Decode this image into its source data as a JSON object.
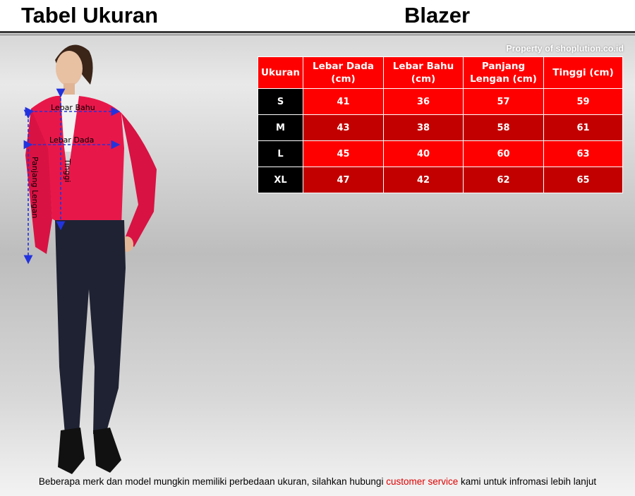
{
  "header": {
    "title": "Tabel Ukuran",
    "product": "Blazer"
  },
  "property_note": "Property of shoplution.co.id",
  "table": {
    "headers": [
      "Ukuran",
      "Lebar Dada\n(cm)",
      "Lebar Bahu\n(cm)",
      "Panjang\nLengan (cm)",
      "Tinggi (cm)"
    ],
    "rows": [
      {
        "size": "S",
        "lebar_dada": "41",
        "lebar_bahu": "36",
        "panjang_lengan": "57",
        "tinggi": "59"
      },
      {
        "size": "M",
        "lebar_dada": "43",
        "lebar_bahu": "38",
        "panjang_lengan": "58",
        "tinggi": "61"
      },
      {
        "size": "L",
        "lebar_dada": "45",
        "lebar_bahu": "40",
        "panjang_lengan": "60",
        "tinggi": "63"
      },
      {
        "size": "XL",
        "lebar_dada": "47",
        "lebar_bahu": "42",
        "panjang_lengan": "62",
        "tinggi": "65"
      }
    ]
  },
  "figure_labels": {
    "lebar_bahu": "Lebar Bahu",
    "lebar_dada": "Lebar Dada",
    "tinggi": "Tinggi",
    "panjang_lengan": "Panjang Lengan"
  },
  "footer": {
    "before": "Beberapa merk dan model mungkin memiliki perbedaan ukuran, silahkan hubungi ",
    "link": "customer service",
    "after": " kami untuk infromasi lebih lanjut"
  },
  "colors": {
    "header_red": "#ff0000",
    "row_dark_red": "#c20000",
    "size_cell": "#000000",
    "blazer": "#e8174a",
    "arrows": "#2233dd"
  }
}
